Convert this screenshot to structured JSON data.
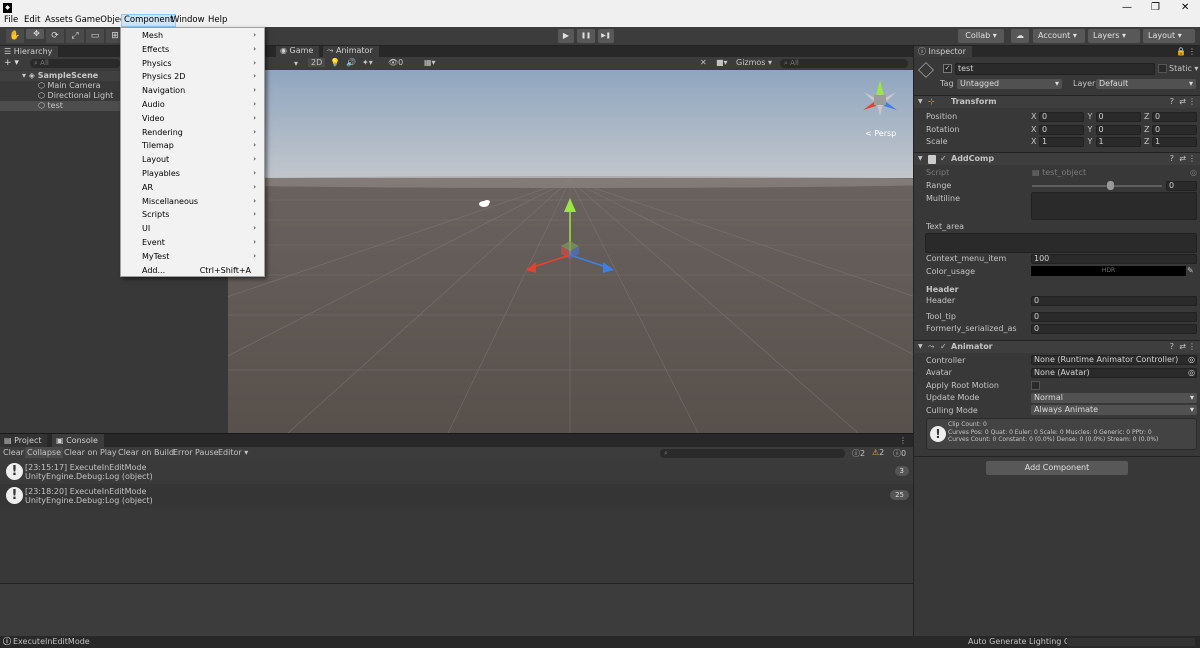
{
  "app": {
    "logo": "◆"
  },
  "menubar": {
    "items": [
      "File",
      "Edit",
      "Assets",
      "GameObject",
      "Component",
      "Window",
      "Help"
    ],
    "active": "Component",
    "window_controls": [
      "—",
      "❐",
      "✕"
    ]
  },
  "toolbar": {
    "play": "▶",
    "pause": "❚❚",
    "step": "▶❚",
    "collab": "Collab ▾",
    "cloud": "☁",
    "account": "Account",
    "layers": "Layers",
    "layout": "Layout"
  },
  "component_menu": {
    "items": [
      {
        "label": "Mesh",
        "arrow": "›"
      },
      {
        "label": "Effects",
        "arrow": "›"
      },
      {
        "label": "Physics",
        "arrow": "›"
      },
      {
        "label": "Physics 2D",
        "arrow": "›"
      },
      {
        "label": "Navigation",
        "arrow": "›"
      },
      {
        "label": "Audio",
        "arrow": "›"
      },
      {
        "label": "Video",
        "arrow": "›"
      },
      {
        "label": "Rendering",
        "arrow": "›"
      },
      {
        "label": "Tilemap",
        "arrow": "›"
      },
      {
        "label": "Layout",
        "arrow": "›"
      },
      {
        "label": "Playables",
        "arrow": "›"
      },
      {
        "label": "AR",
        "arrow": "›"
      },
      {
        "label": "Miscellaneous",
        "arrow": "›"
      },
      {
        "label": "Scripts",
        "arrow": "›"
      },
      {
        "label": "UI",
        "arrow": "›"
      },
      {
        "label": "Event",
        "arrow": "›"
      },
      {
        "label": "MyTest",
        "arrow": "›"
      },
      {
        "label": "Add...",
        "shortcut": "Ctrl+Shift+A"
      }
    ]
  },
  "hierarchy": {
    "tab": "Hierarchy",
    "add": "+ ▾",
    "search_placeholder": "All",
    "scene": "SampleScene",
    "items": [
      "Main Camera",
      "Directional Light",
      "test"
    ]
  },
  "scene_view": {
    "tabs": [
      "Game",
      "Animator"
    ],
    "mode_2d": "2D",
    "gizmos": "Gizmos",
    "search_placeholder": "All",
    "persp": "< Persp",
    "hidden_count": "0"
  },
  "inspector": {
    "tab": "Inspector",
    "object_name": "test",
    "static_label": "Static",
    "tag_label": "Tag",
    "tag_value": "Untagged",
    "layer_label": "Layer",
    "layer_value": "Default",
    "transform": {
      "title": "Transform",
      "rows": [
        {
          "label": "Position",
          "x": "0",
          "y": "0",
          "z": "0"
        },
        {
          "label": "Rotation",
          "x": "0",
          "y": "0",
          "z": "0"
        },
        {
          "label": "Scale",
          "x": "1",
          "y": "1",
          "z": "1"
        }
      ]
    },
    "addcomp": {
      "title": "AddComp",
      "script_label": "Script",
      "script_value": "test_object",
      "range_label": "Range",
      "range_value": "0",
      "range_fraction": 0.6,
      "multiline_label": "Multiline",
      "text_area_label": "Text_area",
      "context_label": "Context_menu_item",
      "context_value": "100",
      "color_label": "Color_usage",
      "color_hdr": "HDR",
      "header_section": "Header",
      "header_label": "Header",
      "header_value": "0",
      "tooltip_label": "Tool_tip",
      "tooltip_value": "0",
      "formerly_label": "Formerly_serialized_as",
      "formerly_value": "0"
    },
    "animator": {
      "title": "Animator",
      "controller_label": "Controller",
      "controller_value": "None (Runtime Animator Controller)",
      "avatar_label": "Avatar",
      "avatar_value": "None (Avatar)",
      "root_motion_label": "Apply Root Motion",
      "update_label": "Update Mode",
      "update_value": "Normal",
      "culling_label": "Culling Mode",
      "culling_value": "Always Animate",
      "info_line1": "Clip Count: 0",
      "info_line2": "Curves Pos: 0 Quat: 0 Euler: 0 Scale: 0 Muscles: 0 Generic: 0 PPtr: 0",
      "info_line3": "Curves Count: 0 Constant: 0 (0.0%) Dense: 0 (0.0%) Stream: 0 (0.0%)"
    },
    "add_component_button": "Add Component"
  },
  "console": {
    "tabs": [
      "Project",
      "Console"
    ],
    "buttons": [
      "Clear",
      "Collapse",
      "Clear on Play",
      "Clear on Build",
      "Error Pause",
      "Editor ▾"
    ],
    "counts": {
      "info": "2",
      "warn": "2",
      "error": "0"
    },
    "logs": [
      {
        "line1": "[23:15:17] ExecuteInEditMode",
        "line2": "UnityEngine.Debug:Log (object)",
        "count": "3"
      },
      {
        "line1": "[23:18:20] ExecuteInEditMode",
        "line2": "UnityEngine.Debug:Log (object)",
        "count": "25"
      }
    ]
  },
  "statusbar": {
    "message": "ExecuteInEditMode",
    "lighting": "Auto Generate Lighting Off"
  },
  "colors": {
    "accent": "#cce4f7",
    "editor_bg": "#383838",
    "scene_ground": "#5e5752"
  }
}
